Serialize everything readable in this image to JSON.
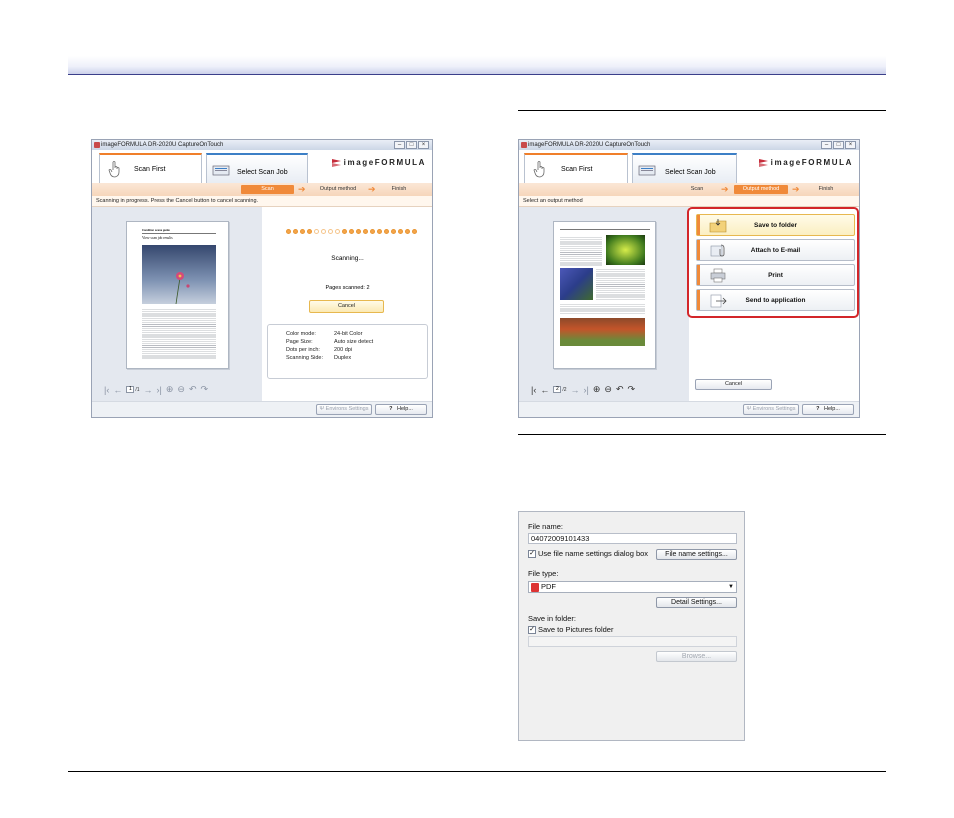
{
  "left_window": {
    "title": "imageFORMULA DR-2020U CaptureOnTouch",
    "tabs": {
      "scan_first": "Scan First",
      "select_scan_job": "Select Scan Job"
    },
    "logo": "imageFORMULA",
    "steps": [
      "Scan",
      "Output method",
      "Finish"
    ],
    "current_step": 0,
    "message": "Scanning in progress. Press the Cancel button to cancel scanning.",
    "page": {
      "heading": "Condition scene guide",
      "subheading": "View scan job results"
    },
    "nav_page_value": "1",
    "nav_page_total": "/1",
    "progress_total_dots": 19,
    "progress_filled_before": 4,
    "progress_empty": 4,
    "status": "Scanning...",
    "pages_scanned": "Pages scanned: 2",
    "cancel": "Cancel",
    "settings": [
      {
        "key": "Color mode:",
        "value": "24-bit Color"
      },
      {
        "key": "Page Size:",
        "value": "Auto size detect"
      },
      {
        "key": "Dots per inch:",
        "value": "200 dpi"
      },
      {
        "key": "Scanning Side:",
        "value": "Duplex"
      }
    ],
    "env_settings": "Environs Settings",
    "help_q": "?",
    "help": "Help..."
  },
  "right_window": {
    "title": "imageFORMULA DR-2020U CaptureOnTouch",
    "tabs": {
      "scan_first": "Scan First",
      "select_scan_job": "Select Scan Job"
    },
    "logo": "imageFORMULA",
    "steps": [
      "Scan",
      "Output method",
      "Finish"
    ],
    "current_step": 1,
    "message": "Select an output method",
    "nav_page_value": "2",
    "nav_page_total": "/2",
    "output_buttons": [
      "Save to folder",
      "Attach to E-mail",
      "Print",
      "Send to application"
    ],
    "cancel": "Cancel",
    "env_settings": "Environs Settings",
    "help_q": "?",
    "help": "Help..."
  },
  "save_panel": {
    "file_name_label": "File name:",
    "file_name_value": "04072009101433",
    "use_settings_checkbox": "Use file name settings dialog box",
    "use_settings_checked": true,
    "file_name_settings_button": "File name settings...",
    "file_type_label": "File type:",
    "file_type_value": "PDF",
    "detail_settings_button": "Detail Settings...",
    "save_in_folder_label": "Save in folder:",
    "save_pictures_checkbox": "Save to Pictures folder",
    "save_pictures_checked": true,
    "folder_value": "",
    "browse_button": "Browse..."
  },
  "colors": {
    "accent_orange": "#f08a3a",
    "highlight_red": "#d3262a",
    "header_blue": "#3b3f8a"
  }
}
